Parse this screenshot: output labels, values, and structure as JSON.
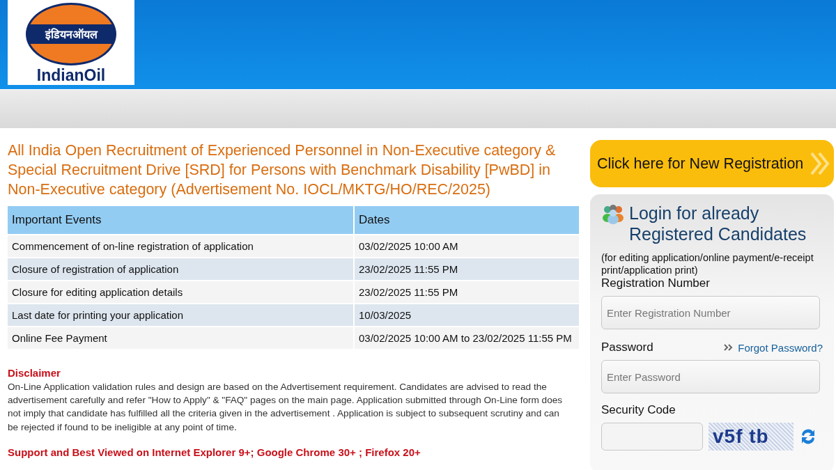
{
  "logo": {
    "hindi": "इंडियनऑयल",
    "english": "IndianOil"
  },
  "title": "All India Open Recruitment of Experienced Personnel in Non-Executive category & Special Recruitment Drive [SRD] for Persons with Benchmark Disability [PwBD] in Non-Executive category (Advertisement No. IOCL/MKTG/HO/REC/2025)",
  "events_table": {
    "columns": [
      "Important Events",
      "Dates"
    ],
    "rows": [
      [
        "Commencement of on-line registration of application",
        "03/02/2025 10:00 AM"
      ],
      [
        "Closure of registration of application",
        "23/02/2025 11:55 PM"
      ],
      [
        "Closure for editing application details",
        "23/02/2025 11:55 PM"
      ],
      [
        "Last date for printing your application",
        "10/03/2025"
      ],
      [
        "Online Fee Payment",
        "03/02/2025 10:00 AM to 23/02/2025 11:55 PM"
      ]
    ]
  },
  "disclaimer": {
    "heading": "Disclaimer",
    "text": "On-Line Application validation rules and design are based on the Advertisement requirement. Candidates are advised to read the advertisement carefully and refer \"How to Apply\" & \"FAQ\" pages on the main page. Application submitted through On-Line form does not imply that candidate has fulfilled all the criteria given in the advertisement . Application is subject to subsequent scrutiny and can be rejected if found to be ineligible at any point of time."
  },
  "browser_note": "Support and Best Viewed on Internet Explorer 9+; Google Chrome 30+ ; Firefox 20+",
  "new_registration_button": "Click here for New Registration",
  "login": {
    "title_lines": [
      "Login for already",
      "Registered Candidates"
    ],
    "note": "(for editing application/online payment/e-receipt print/application print)",
    "registration_label": "Registration Number",
    "registration_placeholder": "Enter Registration Number",
    "password_label": "Password",
    "forgot_link": "Forgot Password?",
    "password_placeholder": "Enter Password",
    "security_label": "Security Code",
    "captcha": "v5f tb"
  }
}
